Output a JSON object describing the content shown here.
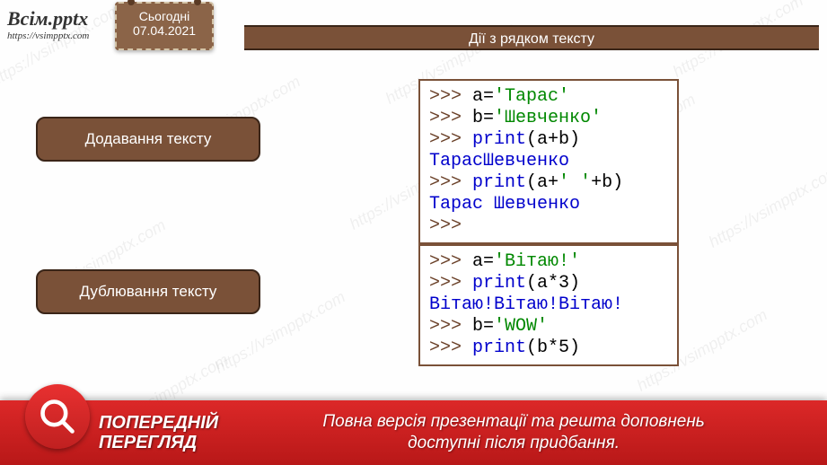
{
  "logo": {
    "name": "Всім.pptx",
    "url": "https://vsimpptx.com"
  },
  "date_tag": {
    "label": "Сьогодні",
    "date": "07.04.2021"
  },
  "title": "Дії з рядком тексту",
  "labels": {
    "add": "Додавання тексту",
    "dup": "Дублювання тексту"
  },
  "code1": {
    "l1_prompt": ">>> ",
    "l1_var": "a=",
    "l1_val": "'Тарас'",
    "l2_prompt": ">>> ",
    "l2_var": "b=",
    "l2_val": "'Шевченко'",
    "l3_prompt": ">>> ",
    "l3_call": "print",
    "l3_arg": "(a+b)",
    "l4_out": "ТарасШевченко",
    "l5_prompt": ">>> ",
    "l5_call": "print",
    "l5_arg1": "(a+",
    "l5_str": "'   '",
    "l5_arg2": "+b)",
    "l6_out": "Тарас   Шевченко",
    "l7_prompt": ">>>"
  },
  "code2": {
    "l1_prompt": ">>> ",
    "l1_var": "a=",
    "l1_val": "'Вітаю!'",
    "l2_prompt": ">>> ",
    "l2_call": "print",
    "l2_arg": "(a*3)",
    "l3_out": "Вітаю!Вітаю!Вітаю!",
    "l4_prompt": ">>> ",
    "l4_var": "b=",
    "l4_val": "'WOW'",
    "l5_prompt": ">>> ",
    "l5_call": "print",
    "l5_arg": "(b*5)"
  },
  "banner": {
    "label_line1": "ПОПЕРЕДНІЙ",
    "label_line2": "ПЕРЕГЛЯД",
    "msg_line1": "Повна версія презентації та решта доповнень",
    "msg_line2": "доступні після придбання."
  },
  "watermark": "https://vsimpptx.com"
}
